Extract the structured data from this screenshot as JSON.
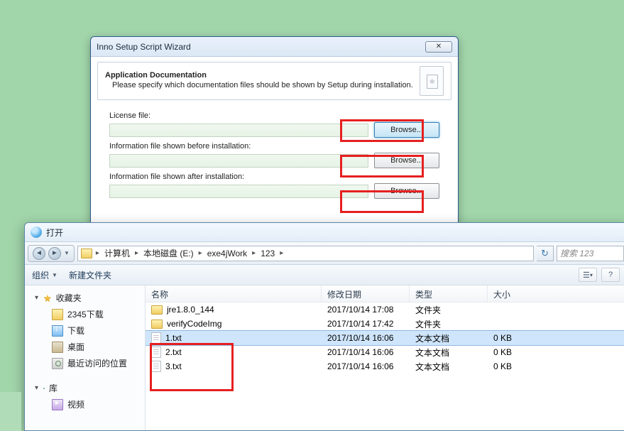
{
  "wizard": {
    "title": "Inno Setup Script Wizard",
    "close_symbol": "✕",
    "header_title": "Application Documentation",
    "header_desc": "Please specify which documentation files should be shown by Setup during installation.",
    "fields": {
      "license_label": "License file:",
      "info_before_label": "Information file shown before installation:",
      "info_after_label": "Information file shown after installation:",
      "browse_label": "Browse..."
    }
  },
  "opendlg": {
    "title": "打开",
    "breadcrumb": {
      "segments": [
        "计算机",
        "本地磁盘 (E:)",
        "exe4jWork",
        "123"
      ],
      "separator": "▸"
    },
    "search_placeholder": "搜索 123",
    "toolbar": {
      "organize": "组织",
      "new_folder": "新建文件夹"
    },
    "sidebar": {
      "favorites_label": "收藏夹",
      "items_fav": [
        "2345下载",
        "下载",
        "桌面",
        "最近访问的位置"
      ],
      "libraries_label": "库",
      "items_lib": [
        "视频"
      ]
    },
    "columns": {
      "name": "名称",
      "date": "修改日期",
      "type": "类型",
      "size": "大小"
    },
    "rows": [
      {
        "name": "jre1.8.0_144",
        "date": "2017/10/14 17:08",
        "type": "文件夹",
        "size": "",
        "kind": "folder",
        "selected": false
      },
      {
        "name": "verifyCodeImg",
        "date": "2017/10/14 17:42",
        "type": "文件夹",
        "size": "",
        "kind": "folder",
        "selected": false
      },
      {
        "name": "1.txt",
        "date": "2017/10/14 16:06",
        "type": "文本文档",
        "size": "0 KB",
        "kind": "file",
        "selected": true
      },
      {
        "name": "2.txt",
        "date": "2017/10/14 16:06",
        "type": "文本文档",
        "size": "0 KB",
        "kind": "file",
        "selected": false
      },
      {
        "name": "3.txt",
        "date": "2017/10/14 16:06",
        "type": "文本文档",
        "size": "0 KB",
        "kind": "file",
        "selected": false
      }
    ]
  }
}
